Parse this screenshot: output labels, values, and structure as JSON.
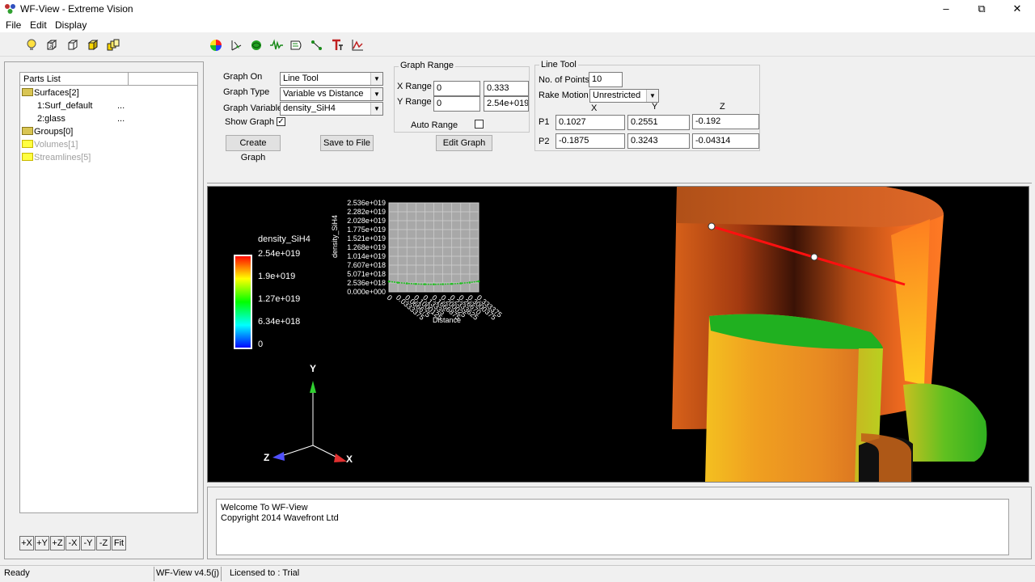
{
  "window": {
    "title": "WF-View - Extreme Vision"
  },
  "menu": [
    "File",
    "Edit",
    "Display"
  ],
  "toolbar": {
    "left_icons": [
      "bulb-icon",
      "cube-wire-icon",
      "cube-outline-icon",
      "cube-solid-icon",
      "cube-multi-icon"
    ],
    "right_icons": [
      "color-wheel-icon",
      "vector-icon",
      "streamline-icon",
      "waveform-icon",
      "surface-icon",
      "line-tool-icon",
      "text-icon",
      "graph-icon"
    ]
  },
  "parts_list": {
    "header": "Parts List",
    "items": [
      {
        "label": "Surfaces[2]",
        "state": "normal"
      },
      {
        "label": "1:Surf_default",
        "dots": "...",
        "state": "normal"
      },
      {
        "label": "2:glass",
        "dots": "...",
        "state": "normal"
      },
      {
        "label": "Groups[0]",
        "state": "normal"
      },
      {
        "label": "Volumes[1]",
        "state": "disabled"
      },
      {
        "label": "Streamlines[5]",
        "state": "disabled"
      }
    ]
  },
  "view_buttons": [
    "+X",
    "+Y",
    "+Z",
    "-X",
    "-Y",
    "-Z",
    "Fit"
  ],
  "graph": {
    "graph_on_label": "Graph On",
    "graph_on_value": "Line Tool",
    "graph_type_label": "Graph Type",
    "graph_type_value": "Variable vs Distance",
    "graph_variable_label": "Graph Variable",
    "graph_variable_value": "density_SiH4",
    "show_graph_label": "Show Graph",
    "show_graph_checked": true,
    "create_button": "Create Graph",
    "save_button": "Save to File"
  },
  "graph_range": {
    "title": "Graph Range",
    "x_label": "X Range",
    "x_min": "0",
    "x_max": "0.333",
    "y_label": "Y Range",
    "y_min": "0",
    "y_max": "2.54e+019",
    "auto_label": "Auto Range",
    "auto_checked": false,
    "edit_button": "Edit Graph"
  },
  "line_tool": {
    "title": "Line Tool",
    "points_label": "No. of Points",
    "points_value": "10",
    "rake_label": "Rake Motion",
    "rake_value": "Unrestricted",
    "col_x": "X",
    "col_y": "Y",
    "col_z": "Z",
    "p1_label": "P1",
    "p1": [
      "0.1027",
      "0.2551",
      "-0.192"
    ],
    "p2_label": "P2",
    "p2": [
      "-0.1875",
      "0.3243",
      "-0.04314"
    ]
  },
  "legend": {
    "title": "density_SiH4",
    "ticks": [
      "2.54e+019",
      "1.9e+019",
      "1.27e+019",
      "6.34e+018",
      "0"
    ]
  },
  "chart_data": {
    "type": "line",
    "ylabel": "density_SiH4",
    "xlabel": "Distance",
    "y_ticks": [
      "2.536e+019",
      "2.282e+019",
      "2.028e+019",
      "1.775e+019",
      "1.521e+019",
      "1.268e+019",
      "1.014e+019",
      "7.607e+018",
      "5.071e+018",
      "2.536e+018",
      "0.000e+000"
    ],
    "x_ticks": [
      "0",
      "0.0333375",
      "0.066675",
      "0.1000125",
      "0.13335",
      "0.1666875",
      "0.200025",
      "0.2333625",
      "0.26670",
      "0.3000375",
      "0.333375"
    ],
    "ylim": [
      0,
      2.536e+19
    ],
    "xlim": [
      0,
      0.333375
    ],
    "series": [
      {
        "color": "#22c022",
        "x": [
          0,
          0.0333375,
          0.066675,
          0.1000125,
          0.13335,
          0.1666875,
          0.200025,
          0.2333625,
          0.2667,
          0.3000375,
          0.333375
        ],
        "values": [
          2.95e+18,
          2.62e+18,
          2.4e+18,
          2.25e+18,
          2.17e+18,
          2.15e+18,
          2.18e+18,
          2.26e+18,
          2.42e+18,
          2.65e+18,
          2.98e+18
        ]
      }
    ]
  },
  "axes": {
    "y": "Y",
    "x": "X",
    "z": "Z"
  },
  "console": {
    "line1": "Welcome To WF-View",
    "line2": "Copyright 2014 Wavefront Ltd"
  },
  "status": {
    "ready": "Ready",
    "version": "WF-View v4.5(j)",
    "license": "Licensed to : Trial"
  }
}
